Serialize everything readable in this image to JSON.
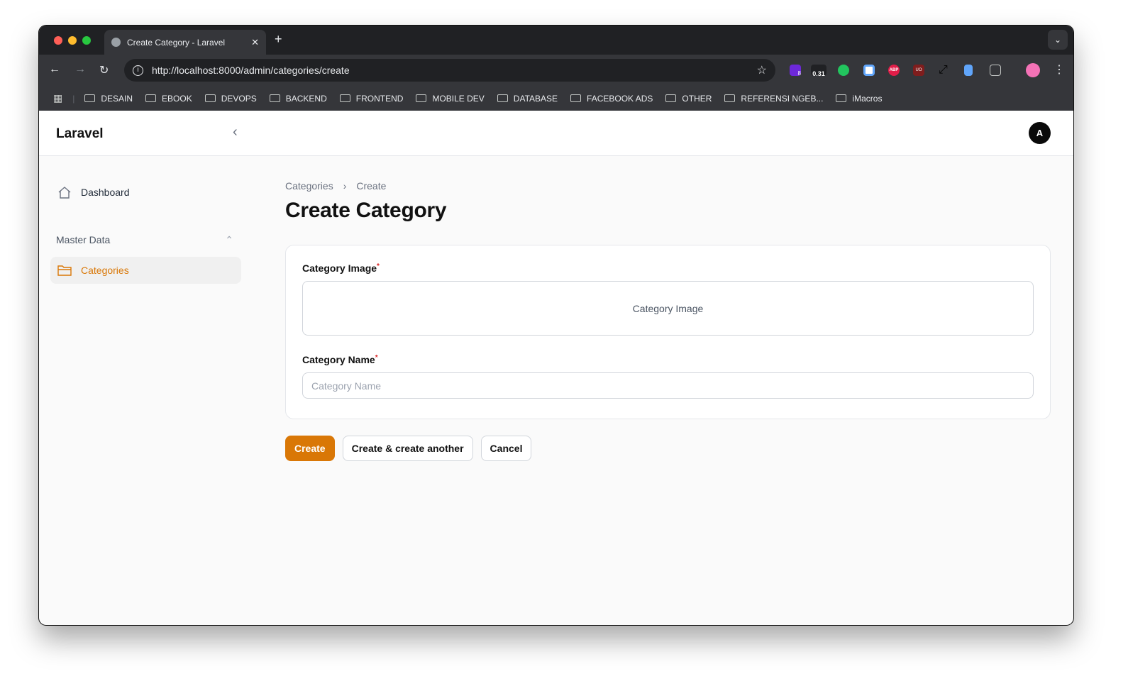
{
  "browser": {
    "tab_title": "Create Category - Laravel",
    "url": "http://localhost:8000/admin/categories/create",
    "ext_badge_count": "8",
    "ext_badge_value": "0.31",
    "ext_abp": "ABP",
    "ext_ublock": "UO",
    "bookmarks": [
      "DESAIN",
      "EBOOK",
      "DEVOPS",
      "BACKEND",
      "FRONTEND",
      "MOBILE DEV",
      "DATABASE",
      "FACEBOOK ADS",
      "OTHER",
      "REFERENSI NGEB...",
      "iMacros"
    ]
  },
  "app": {
    "brand": "Laravel",
    "avatar_initial": "A",
    "accent": "#d97706"
  },
  "sidebar": {
    "dashboard": "Dashboard",
    "group": "Master Data",
    "categories": "Categories"
  },
  "main": {
    "breadcrumb": [
      "Categories",
      "Create"
    ],
    "title": "Create Category",
    "image_label": "Category Image",
    "image_placeholder": "Category Image",
    "name_label": "Category Name",
    "name_placeholder": "Category Name",
    "required_mark": "*",
    "create": "Create",
    "create_another": "Create & create another",
    "cancel": "Cancel"
  }
}
